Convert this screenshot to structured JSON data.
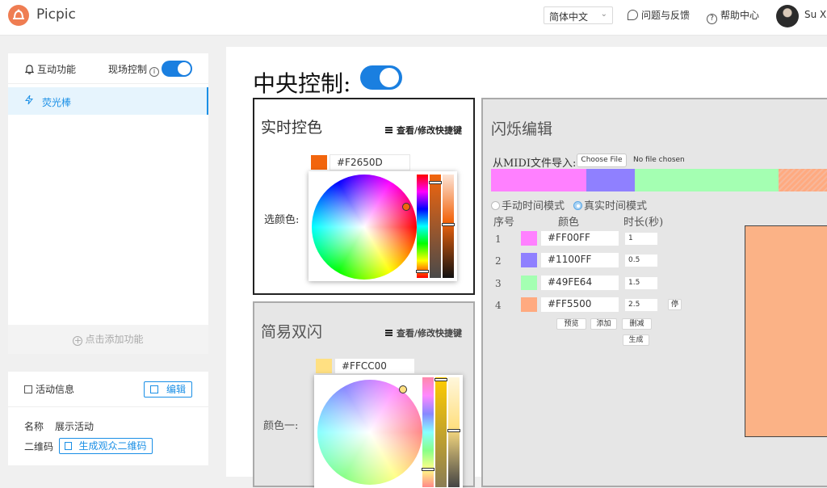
{
  "app": {
    "title": "Picpic",
    "language": "简体中文",
    "links": {
      "feedback": "问题与反馈",
      "help": "帮助中心"
    },
    "user": "Su Xi"
  },
  "sidebar": {
    "interactive": {
      "title": "互动功能",
      "live_control": "现场控制",
      "live_control_on": true,
      "items": [
        {
          "label": "荧光棒",
          "icon": "lightning-icon",
          "selected": true
        }
      ],
      "add_feature": "点击添加功能"
    },
    "event": {
      "title": "活动信息",
      "edit_label": "编辑",
      "name_label": "名称",
      "name_value": "展示活动",
      "qr_label": "二维码",
      "qr_button": "生成观众二维码"
    }
  },
  "main": {
    "title": "中央控制:",
    "central_on": true,
    "realtime": {
      "title": "实时控色",
      "shortcut": "查看/修改快捷键",
      "color_hex": "#F2650D",
      "color": "#F2650D",
      "pick_label": "选颜色:"
    },
    "double_flash": {
      "title": "简易双闪",
      "shortcut": "查看/修改快捷键",
      "color_hex": "#FFCC00",
      "color": "#FFE082",
      "color1_label": "颜色一:"
    },
    "flash_edit": {
      "title": "闪烁编辑",
      "midi_label": "从MIDI文件导入:",
      "choose_file": "Choose File",
      "no_file": "No file chosen",
      "modes": [
        {
          "label": "手动时间模式",
          "selected": false
        },
        {
          "label": "真实时间模式",
          "selected": true
        }
      ],
      "headers": [
        "序号",
        "颜色",
        "时长(秒)"
      ],
      "rows": [
        {
          "index": "1",
          "hex": "#FF00FF",
          "duration": "1",
          "color": "#FF80FF"
        },
        {
          "index": "2",
          "hex": "#1100FF",
          "duration": "0.5",
          "color": "#8F80FF"
        },
        {
          "index": "3",
          "hex": "#49FE64",
          "duration": "1.5",
          "color": "#A4FFB2"
        },
        {
          "index": "4",
          "hex": "#FF5500",
          "duration": "2.5",
          "color": "#FFAA80",
          "stop_label": "停"
        }
      ],
      "buttons": {
        "preview": "预览",
        "add": "添加",
        "delete": "删减",
        "generate": "生成"
      },
      "preview_color": "#FBB286"
    }
  }
}
